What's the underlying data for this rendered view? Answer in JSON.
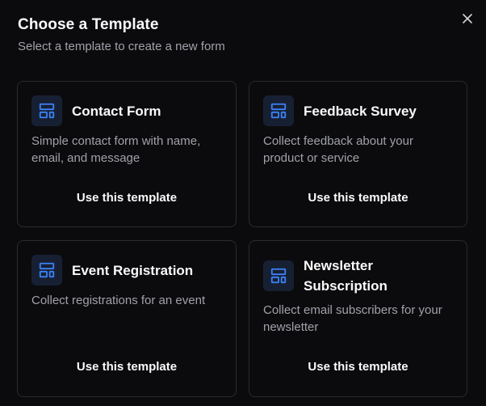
{
  "dialog": {
    "title": "Choose a Template",
    "subtitle": "Select a template to create a new form"
  },
  "colors": {
    "background": "#0b0b0d",
    "card_border": "#2a2a30",
    "icon_bg": "#172033",
    "icon_accent": "#3b82f6",
    "muted_text": "#a1a1aa"
  },
  "templates": [
    {
      "title": "Contact Form",
      "description": "Simple contact form with name, email, and message",
      "action": "Use this template",
      "icon": "layout-template-icon"
    },
    {
      "title": "Feedback Survey",
      "description": "Collect feedback about your product or service",
      "action": "Use this template",
      "icon": "layout-template-icon"
    },
    {
      "title": "Event Registration",
      "description": "Collect registrations for an event",
      "action": "Use this template",
      "icon": "layout-template-icon"
    },
    {
      "title": "Newsletter Subscription",
      "description": "Collect email subscribers for your newsletter",
      "action": "Use this template",
      "icon": "layout-template-icon"
    }
  ]
}
